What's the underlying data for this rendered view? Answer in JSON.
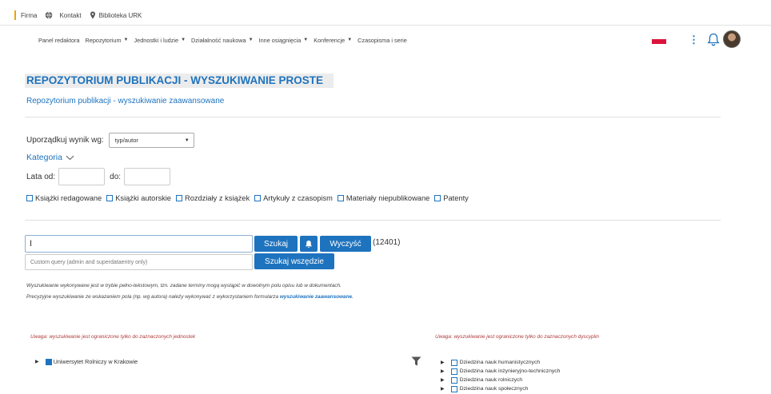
{
  "topbar": {
    "items": [
      {
        "label": "Firma",
        "icon": "none"
      },
      {
        "label": "Kontakt",
        "icon": "globe-icon"
      },
      {
        "label": "Biblioteka URK",
        "icon": "pin-icon"
      }
    ]
  },
  "nav": {
    "items": [
      {
        "label": "Panel redaktora",
        "dropdown": false
      },
      {
        "label": "Repozytorium",
        "dropdown": true
      },
      {
        "label": "Jednostki i ludzie",
        "dropdown": true
      },
      {
        "label": "Działalność naukowa",
        "dropdown": true
      },
      {
        "label": "Inne osiągnięcia",
        "dropdown": true
      },
      {
        "label": "Konferencje",
        "dropdown": true
      },
      {
        "label": "Czasopisma i serie",
        "dropdown": false
      }
    ],
    "kebab": "⋮"
  },
  "page": {
    "title": "REPOZYTORIUM PUBLIKACJI - WYSZUKIWANIE PROSTE",
    "advanced_link": "Repozytorium publikacji - wyszukiwanie zaawansowane"
  },
  "filters": {
    "sort_label": "Uporządkuj wynik wg:",
    "sort_value": "typ/autor",
    "category_label": "Kategoria",
    "years_from_label": "Lata od:",
    "years_to_label": "do:",
    "categories": [
      "Książki redagowane",
      "Książki autorskie",
      "Rozdziały z książek",
      "Artykuły z czasopism",
      "Materiały niepublikowane",
      "Patenty"
    ]
  },
  "search": {
    "value": "I",
    "search_button": "Szukaj",
    "clear_button": "Wyczyść",
    "count": "(12401)",
    "custom_query_placeholder": "Custom query (admin and superdataentry only)",
    "search_everywhere_button": "Szukaj wszędzie"
  },
  "info": {
    "line1": "Wyszukiwanie wykonywane jest w trybie pełno-tekstowym, tzn. zadane terminy mogą wystąpić w dowolnym polu opisu lub w dokumentach.",
    "line2_prefix": "Precyzyjne wyszukiwanie ze wskazaniem pola (np. wg autora) należy wykonywać z wykorzystaniem formularza ",
    "line2_link": "wyszukiwanie zaawansowane",
    "line2_suffix": "."
  },
  "units": {
    "warning": "Uwaga: wyszukiwanie jest ograniczone tylko do zaznaczonych jednostek",
    "root": "Uniwersytet Rolniczy w Krakowie"
  },
  "disciplines": {
    "warning": "Uwaga: wyszukiwanie jest ograniczone tylko do zaznaczonych dyscyplin",
    "items": [
      "Dziedzina nauk humanistycznych",
      "Dziedzina nauk inżynieryjno-technicznych",
      "Dziedzina nauk rolniczych",
      "Dziedzina nauk społecznych"
    ]
  },
  "colors": {
    "accent": "#1e73be",
    "warning": "#b03a3a",
    "title_bg": "#ececec"
  }
}
